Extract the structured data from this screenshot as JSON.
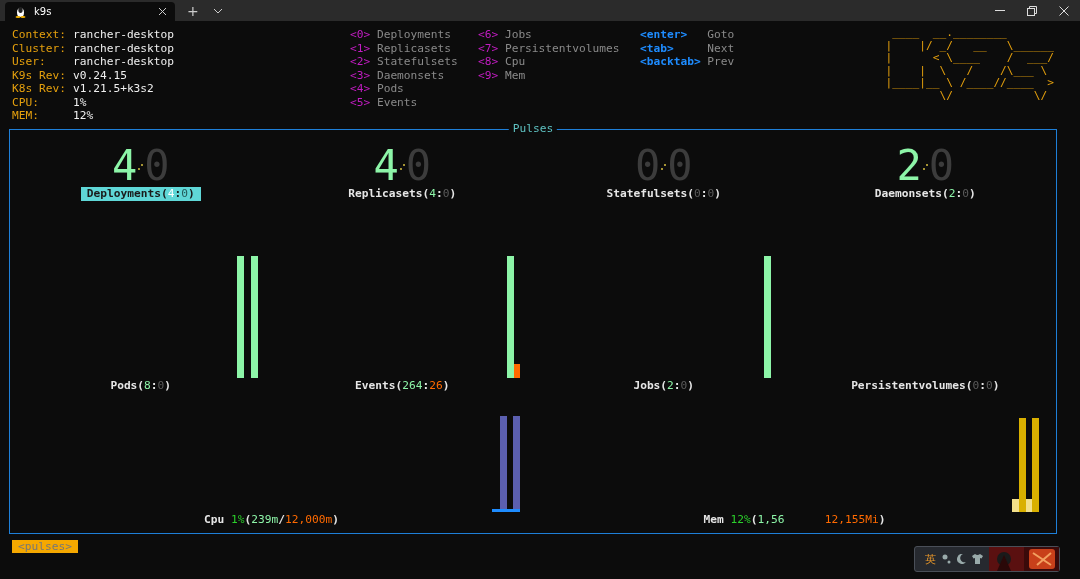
{
  "window": {
    "tab_title": "k9s",
    "new_tab": "+"
  },
  "info": [
    {
      "key": "Context:",
      "value": "rancher-desktop"
    },
    {
      "key": "Cluster:",
      "value": "rancher-desktop"
    },
    {
      "key": "User:",
      "value": "rancher-desktop"
    },
    {
      "key": "K9s Rev:",
      "value": "v0.24.15"
    },
    {
      "key": "K8s Rev:",
      "value": "v1.21.5+k3s2"
    },
    {
      "key": "CPU:",
      "value": "1%"
    },
    {
      "key": "MEM:",
      "value": "12%"
    }
  ],
  "hotkey_columns": [
    [
      {
        "key": "<0>",
        "label": "Deployments",
        "kind": "view"
      },
      {
        "key": "<1>",
        "label": "Replicasets",
        "kind": "view"
      },
      {
        "key": "<2>",
        "label": "Statefulsets",
        "kind": "view"
      },
      {
        "key": "<3>",
        "label": "Daemonsets",
        "kind": "view"
      },
      {
        "key": "<4>",
        "label": "Pods",
        "kind": "view"
      },
      {
        "key": "<5>",
        "label": "Events",
        "kind": "view"
      }
    ],
    [
      {
        "key": "<6>",
        "label": "Jobs",
        "kind": "view"
      },
      {
        "key": "<7>",
        "label": "Persistentvolumes",
        "kind": "view"
      },
      {
        "key": "<8>",
        "label": "Cpu",
        "kind": "view"
      },
      {
        "key": "<9>",
        "label": "Mem",
        "kind": "view"
      }
    ],
    [
      {
        "key": "<enter>",
        "label": "Goto",
        "kind": "nav"
      },
      {
        "key": "<tab>",
        "label": "Next",
        "kind": "nav"
      },
      {
        "key": "<backtab>",
        "label": "Prev",
        "kind": "nav"
      }
    ]
  ],
  "logo_lines": [
    " ____  __.________       ",
    "|    |/ _/   __   \\______",
    "|      < \\____    /  ___/",
    "|    |  \\   /    /\\___ \\ ",
    "|____|__ \\ /____//____  >",
    "        \\/            \\/ "
  ],
  "pulses": {
    "title": "Pulses",
    "counters": [
      {
        "big_ok": "4",
        "big_fail": "0",
        "selected": true,
        "label": [
          {
            "text": "Deployments(",
            "kind": "plain"
          },
          {
            "text": "4",
            "kind": "ok"
          },
          {
            "text": ":",
            "kind": "plain"
          },
          {
            "text": "0",
            "kind": "dim"
          },
          {
            "text": ")",
            "kind": "plain"
          }
        ]
      },
      {
        "big_ok": "4",
        "big_fail": "0",
        "selected": false,
        "label": [
          {
            "text": "Replicasets(",
            "kind": "plain"
          },
          {
            "text": "4",
            "kind": "ok"
          },
          {
            "text": ":",
            "kind": "plain"
          },
          {
            "text": "0",
            "kind": "dim"
          },
          {
            "text": ")",
            "kind": "plain"
          }
        ]
      },
      {
        "big_ok": "0",
        "big_fail": "0",
        "ok_active": false,
        "selected": false,
        "label": [
          {
            "text": "Statefulsets(",
            "kind": "plain"
          },
          {
            "text": "0",
            "kind": "dim"
          },
          {
            "text": ":",
            "kind": "plain"
          },
          {
            "text": "0",
            "kind": "dim"
          },
          {
            "text": ")",
            "kind": "plain"
          }
        ]
      },
      {
        "big_ok": "2",
        "big_fail": "0",
        "selected": false,
        "label": [
          {
            "text": "Daemonsets(",
            "kind": "plain"
          },
          {
            "text": "2",
            "kind": "ok"
          },
          {
            "text": ":",
            "kind": "plain"
          },
          {
            "text": "0",
            "kind": "dim"
          },
          {
            "text": ")",
            "kind": "plain"
          }
        ]
      }
    ],
    "charts": [
      {
        "label": [
          {
            "text": "Pods(",
            "kind": "plain"
          },
          {
            "text": "8",
            "kind": "ok"
          },
          {
            "text": ":",
            "kind": "plain"
          },
          {
            "text": "0",
            "kind": "dim"
          },
          {
            "text": ")",
            "kind": "plain"
          }
        ]
      },
      {
        "label": [
          {
            "text": "Events(",
            "kind": "plain"
          },
          {
            "text": "264",
            "kind": "ok"
          },
          {
            "text": ":",
            "kind": "plain"
          },
          {
            "text": "26",
            "kind": "bad"
          },
          {
            "text": ")",
            "kind": "plain"
          }
        ]
      },
      {
        "label": [
          {
            "text": "Jobs(",
            "kind": "plain"
          },
          {
            "text": "2",
            "kind": "ok"
          },
          {
            "text": ":",
            "kind": "plain"
          },
          {
            "text": "0",
            "kind": "dim"
          },
          {
            "text": ")",
            "kind": "plain"
          }
        ]
      },
      {
        "label": [
          {
            "text": "Persistentvolumes(",
            "kind": "plain"
          },
          {
            "text": "0",
            "kind": "dim"
          },
          {
            "text": ":",
            "kind": "plain"
          },
          {
            "text": "0",
            "kind": "dim"
          },
          {
            "text": ")",
            "kind": "plain"
          }
        ]
      }
    ],
    "gauges": [
      {
        "kind": "cpu",
        "label": [
          {
            "text": "Cpu ",
            "kind": "plain"
          },
          {
            "text": "1%",
            "kind": "pct"
          },
          {
            "text": "(",
            "kind": "plain"
          },
          {
            "text": "239m",
            "kind": "ok"
          },
          {
            "text": "/",
            "kind": "plain"
          },
          {
            "text": "12,000m",
            "kind": "bad"
          },
          {
            "text": ")",
            "kind": "plain"
          }
        ]
      },
      {
        "kind": "mem",
        "label": [
          {
            "text": "Mem ",
            "kind": "plain"
          },
          {
            "text": "12%",
            "kind": "pct"
          },
          {
            "text": "(",
            "kind": "plain"
          },
          {
            "text": "1,56",
            "kind": "ok"
          },
          {
            "text": "12,155Mi",
            "kind": "bad",
            "gap_before": true
          },
          {
            "text": ")",
            "kind": "plain"
          }
        ]
      }
    ]
  },
  "footer": {
    "crumb": "<pulses>"
  },
  "ime": {
    "mode": "英"
  }
}
